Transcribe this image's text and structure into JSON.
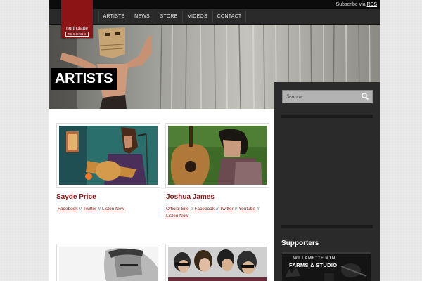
{
  "header": {
    "subscribe_prefix": "Subscribe via",
    "subscribe_link": "RSS",
    "logo_line1": "northplatte",
    "logo_line2": "RECORDS"
  },
  "nav": {
    "items": [
      {
        "label": "ARTISTS"
      },
      {
        "label": "NEWS"
      },
      {
        "label": "STORE"
      },
      {
        "label": "VIDEOS"
      },
      {
        "label": "CONTACT"
      }
    ]
  },
  "hero": {
    "title": "ARTISTS"
  },
  "search": {
    "placeholder": "Search"
  },
  "sidebar": {
    "supporters_heading": "Supporters",
    "sponsor_line1": "WILLAMETTE MTN",
    "sponsor_line2": "FARMS & STUDIO"
  },
  "artists": [
    {
      "name": "Sayde Price",
      "links": [
        "Facebook",
        "Twitter",
        "Listen Now"
      ]
    },
    {
      "name": "Joshua James",
      "links": [
        "Official Site",
        "Facebook",
        "Twitter",
        "Youtube",
        "Listen Now"
      ]
    }
  ],
  "separators": {
    "link": "//"
  },
  "colors": {
    "brand_red": "#8c1414",
    "link_red": "#8e1818",
    "sidebar_bg": "#2a2a2a",
    "nav_bg": "#2a2a2a"
  }
}
